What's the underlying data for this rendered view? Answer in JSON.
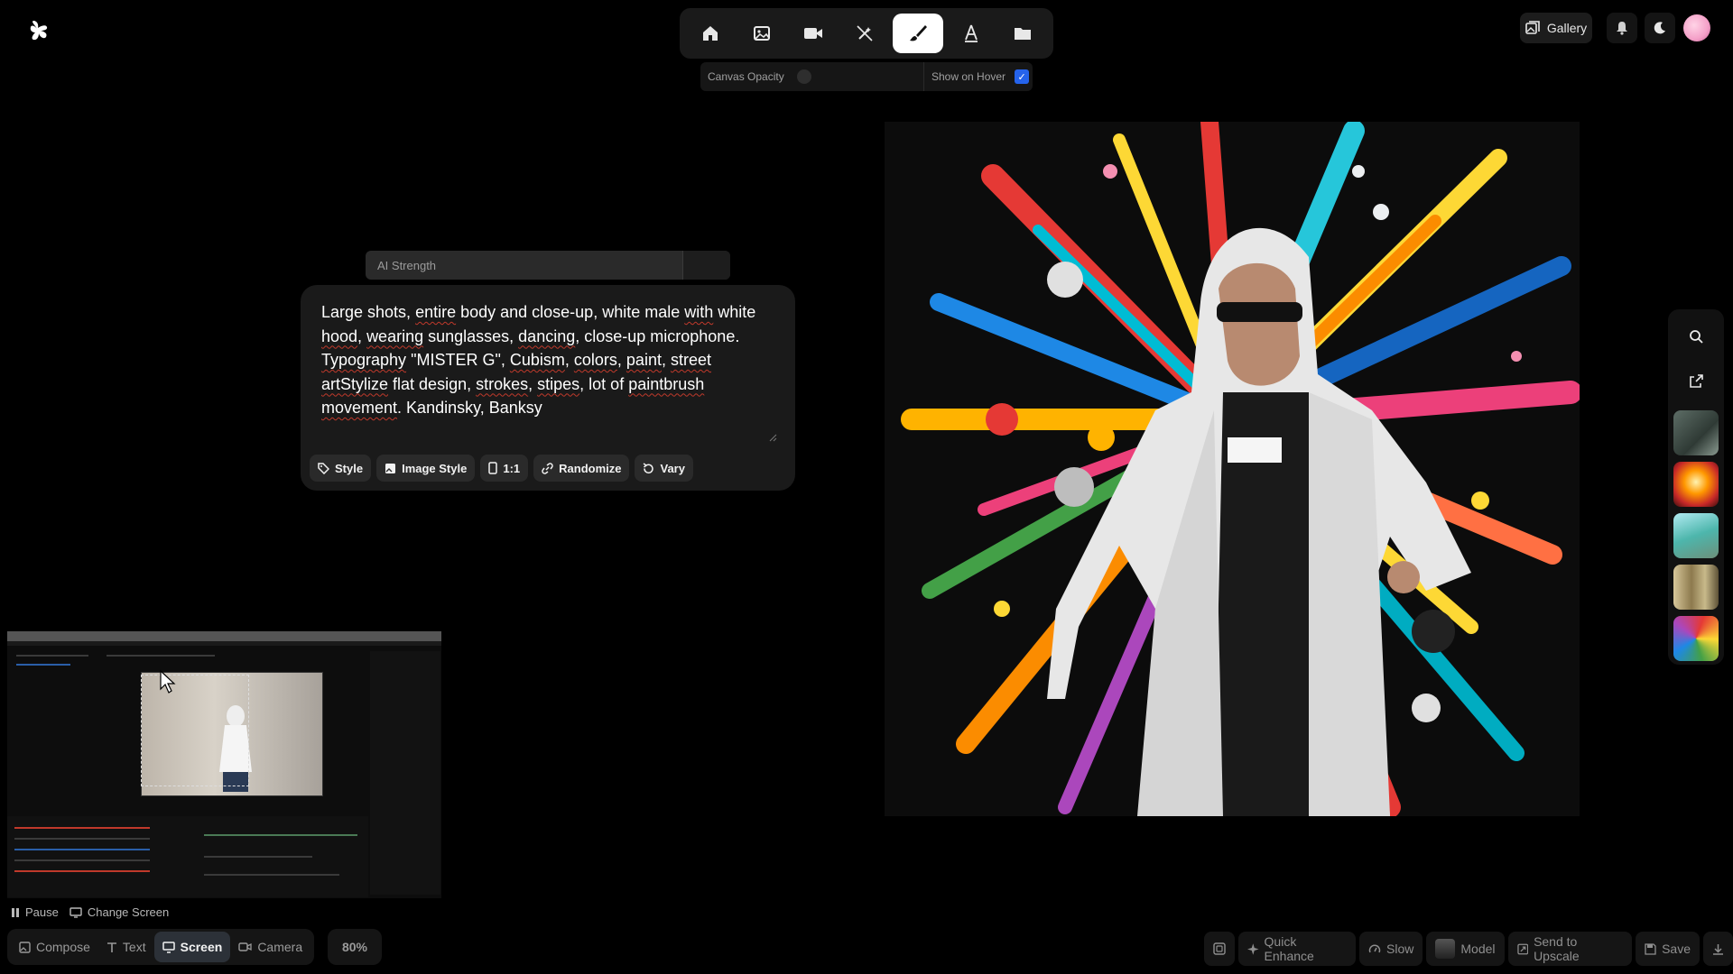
{
  "toolbar": {
    "items": [
      {
        "icon": "home-icon"
      },
      {
        "icon": "image-icon"
      },
      {
        "icon": "video-icon"
      },
      {
        "icon": "magic-wand-off-icon"
      },
      {
        "icon": "brush-icon",
        "active": true
      },
      {
        "icon": "text-icon"
      },
      {
        "icon": "folder-icon"
      }
    ]
  },
  "canvas": {
    "opacity_label": "Canvas Opacity",
    "hover_label": "Show on Hover",
    "show_on_hover": true
  },
  "header_right": {
    "gallery_label": "Gallery"
  },
  "ai_strength": {
    "label": "AI Strength"
  },
  "prompt": {
    "text_parts": [
      "Large shots, ",
      "entire",
      " body and close-up, white male ",
      "with",
      " white ",
      "hood",
      ", ",
      "wearing",
      " sunglasses, ",
      "dancing",
      ", close-up microphone. ",
      "Typography",
      " \"MISTER G\", ",
      "Cubism",
      ", ",
      "colors",
      ", ",
      "paint",
      ", ",
      "street",
      " ",
      "artStylize",
      " flat design, ",
      "strokes",
      ", ",
      "stipes",
      ", lot of ",
      "paintbrush",
      " ",
      "movement",
      ". Kandinsky, Banksy"
    ]
  },
  "chips": {
    "style": "Style",
    "image_style": "Image Style",
    "ratio": "1:1",
    "randomize": "Randomize",
    "vary": "Vary"
  },
  "screen_share": {
    "pause_label": "Pause",
    "change_label": "Change Screen"
  },
  "modes": {
    "compose": "Compose",
    "text": "Text",
    "screen": "Screen",
    "camera": "Camera",
    "active": "screen"
  },
  "zoom": "80%",
  "actions": {
    "quick_enhance": "Quick Enhance",
    "slow": "Slow",
    "model": "Model",
    "send_to_upscale": "Send to Upscale",
    "save": "Save"
  },
  "colors": {
    "accent_blue": "#2563eb",
    "panel": "#1a1a1a",
    "background": "#000000"
  }
}
